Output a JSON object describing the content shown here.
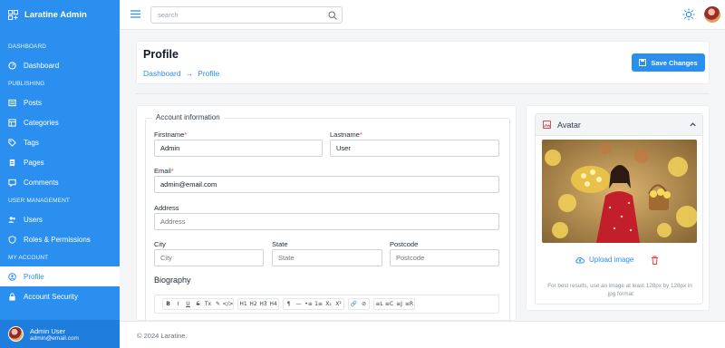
{
  "app": {
    "title": "Laratine Admin"
  },
  "sidebar": {
    "sections": [
      {
        "label": "DASHBOARD",
        "items": [
          {
            "label": "Dashboard",
            "icon": "dashboard-icon"
          }
        ]
      },
      {
        "label": "PUBLISHING",
        "items": [
          {
            "label": "Posts",
            "icon": "posts-icon"
          },
          {
            "label": "Categories",
            "icon": "categories-icon"
          },
          {
            "label": "Tags",
            "icon": "tag-icon"
          },
          {
            "label": "Pages",
            "icon": "pages-icon"
          },
          {
            "label": "Comments",
            "icon": "comment-icon"
          }
        ]
      },
      {
        "label": "USER MANAGEMENT",
        "items": [
          {
            "label": "Users",
            "icon": "users-icon"
          },
          {
            "label": "Roles & Permissions",
            "icon": "shield-icon"
          }
        ]
      },
      {
        "label": "MY ACCOUNT",
        "items": [
          {
            "label": "Profile",
            "icon": "profile-icon",
            "active": true
          },
          {
            "label": "Account Security",
            "icon": "lock-icon"
          }
        ]
      }
    ],
    "user": {
      "name": "Admin User",
      "email": "admin@email.com"
    }
  },
  "topbar": {
    "search_placeholder": "search"
  },
  "header": {
    "title": "Profile",
    "breadcrumb": [
      "Dashboard",
      "Profile"
    ],
    "breadcrumb_sep": "→",
    "save_label": "Save Changes"
  },
  "form": {
    "legend": "Account information",
    "firstname": {
      "label": "Firstname",
      "value": "Admin",
      "required": "*"
    },
    "lastname": {
      "label": "Lastname",
      "value": "User",
      "required": "*"
    },
    "email": {
      "label": "Email",
      "value": "admin@email.com",
      "required": "*"
    },
    "address": {
      "label": "Address",
      "placeholder": "Address"
    },
    "city": {
      "label": "City",
      "placeholder": "City"
    },
    "state": {
      "label": "State",
      "placeholder": "State"
    },
    "postcode": {
      "label": "Postcode",
      "placeholder": "Postcode"
    },
    "biography_label": "Biography",
    "editor_toolbar": [
      [
        "B",
        "I",
        "U",
        "S",
        "Tx",
        "✎",
        "</>"
      ],
      [
        "H1",
        "H2",
        "H3",
        "H4"
      ],
      [
        "¶",
        "—",
        "•≡",
        "1≡",
        "X₂",
        "X²"
      ],
      [
        "🔗",
        "⊘"
      ],
      [
        "≡L",
        "≡C",
        "≡J",
        "≡R"
      ]
    ]
  },
  "avatar_card": {
    "title": "Avatar",
    "upload_label": "Upload image",
    "hint": "For best results, use an image at least 128px by 128px in .jpg format"
  },
  "footer": {
    "text": "© 2024 Laratine."
  },
  "colors": {
    "primary": "#2b8fef",
    "danger": "#ef4444"
  }
}
